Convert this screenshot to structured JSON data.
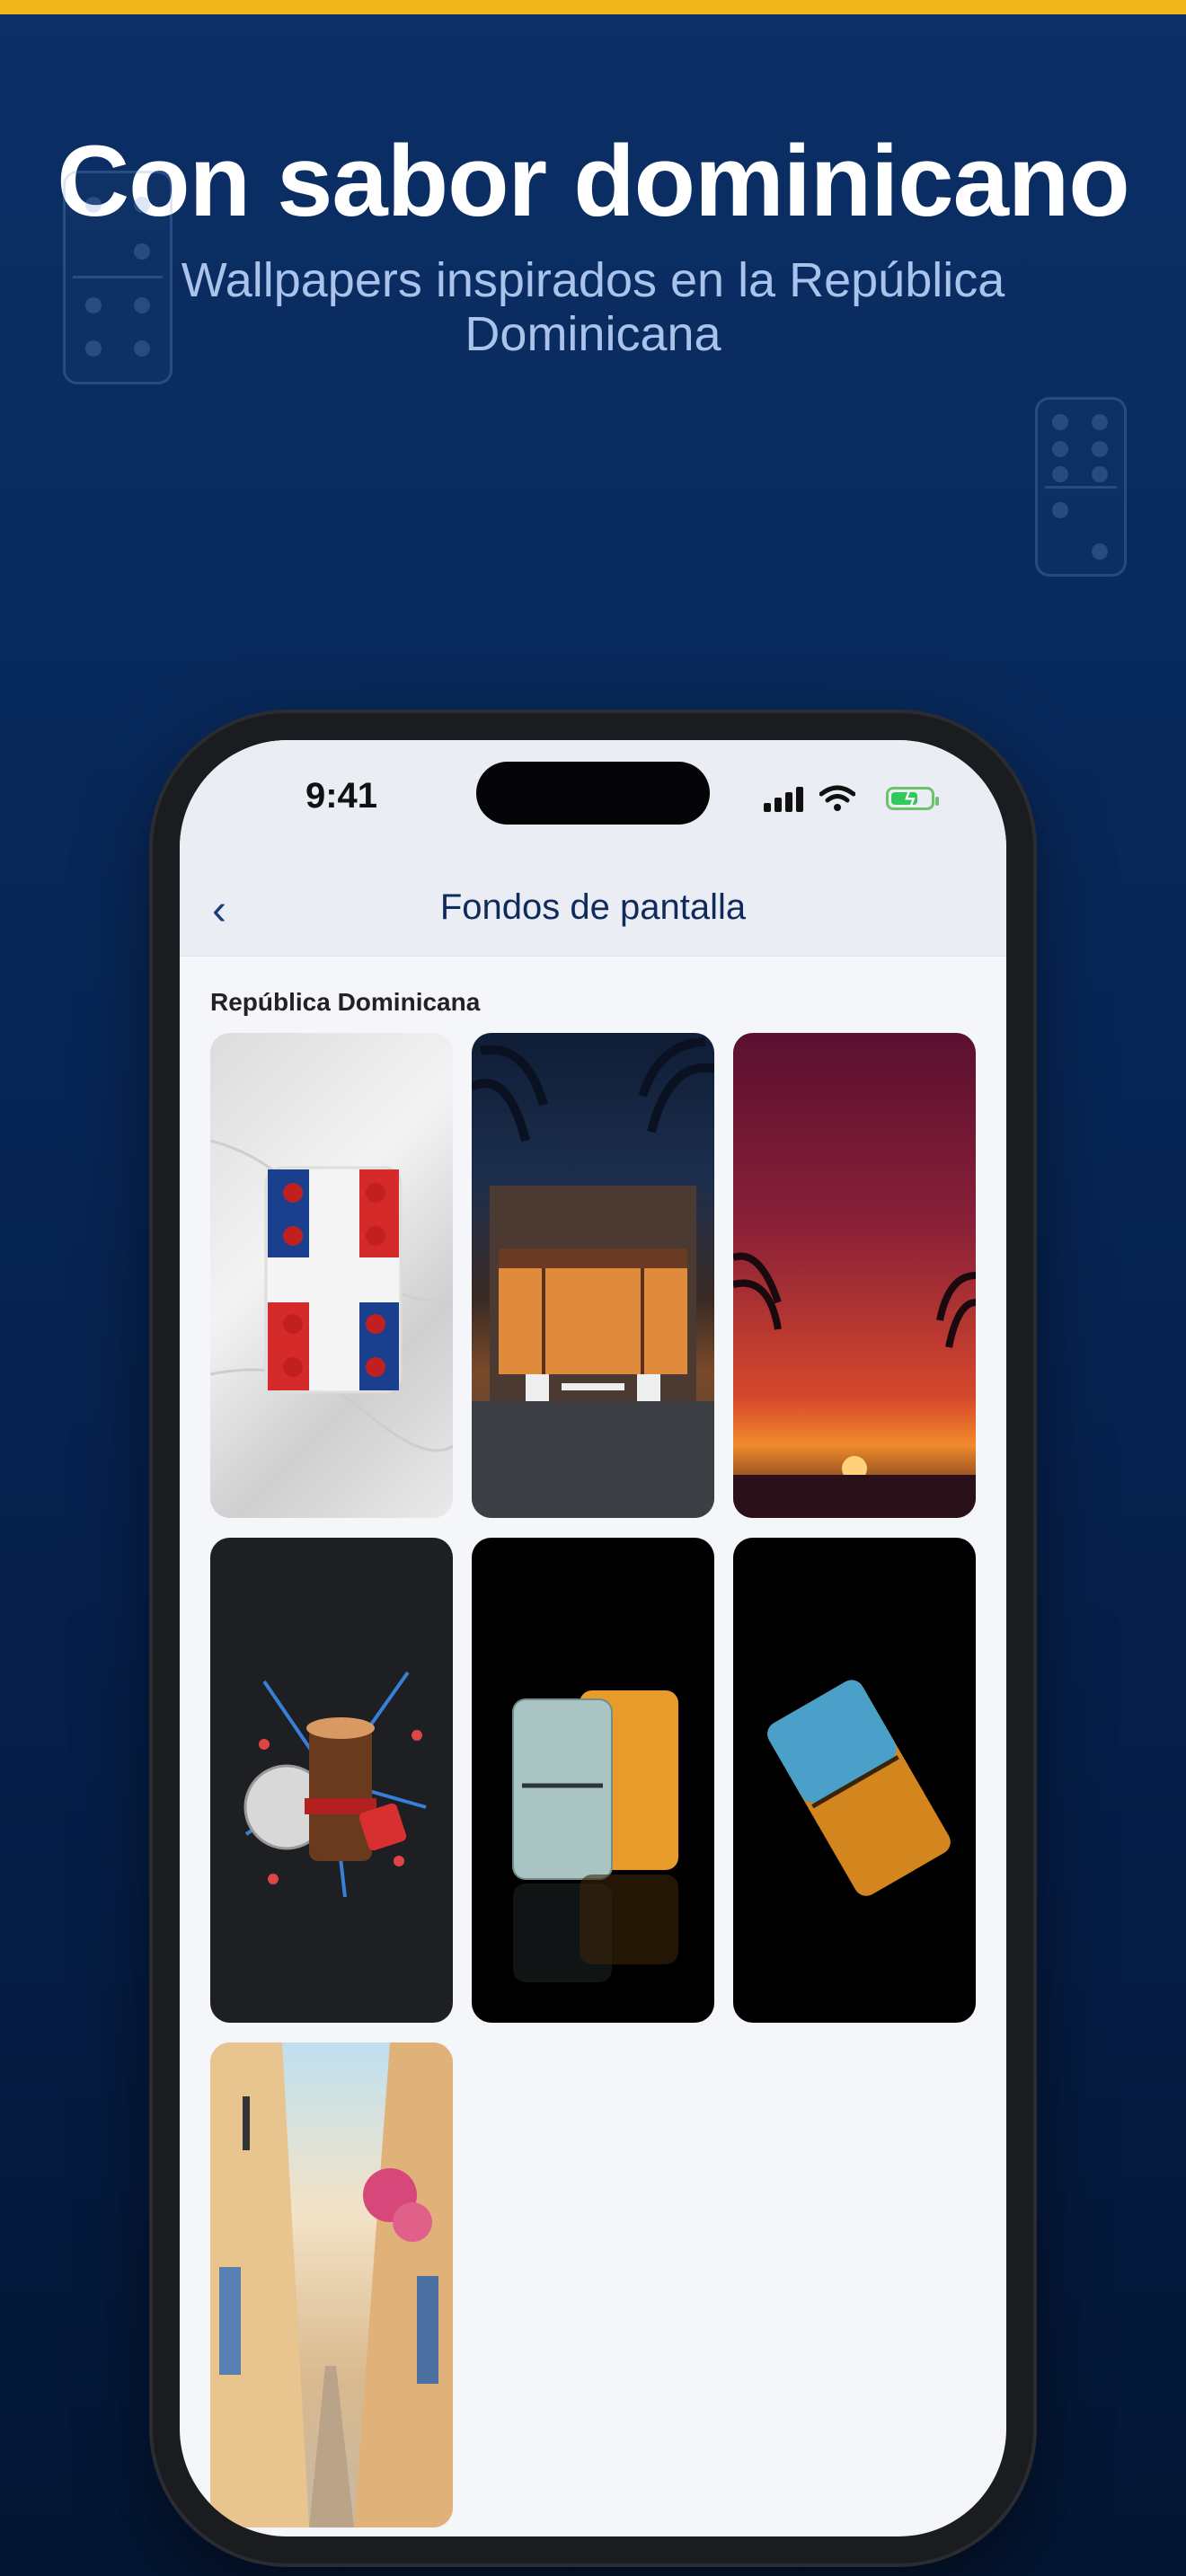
{
  "promo": {
    "headline": "Con sabor dominicano",
    "subline": "Wallpapers inspirados en la República Dominicana"
  },
  "status_bar": {
    "time": "9:41",
    "battery_icon": "battery-charging-icon",
    "wifi_icon": "wifi-icon",
    "signal_icon": "cellular-signal-icon"
  },
  "nav": {
    "back_glyph": "‹",
    "title": "Fondos de pantalla"
  },
  "section": {
    "label": "República Dominicana"
  },
  "wallpapers": [
    {
      "subject": "domino-flag"
    },
    {
      "subject": "colmado-night"
    },
    {
      "subject": "palm-sunset"
    },
    {
      "subject": "tambora-guira"
    },
    {
      "subject": "marble-dominoes"
    },
    {
      "subject": "amber-domino"
    },
    {
      "subject": "colonial-street"
    }
  ],
  "colors": {
    "accent": "#f2b71c",
    "background": "#0b2f66",
    "nav_title": "#0f2b5c"
  }
}
